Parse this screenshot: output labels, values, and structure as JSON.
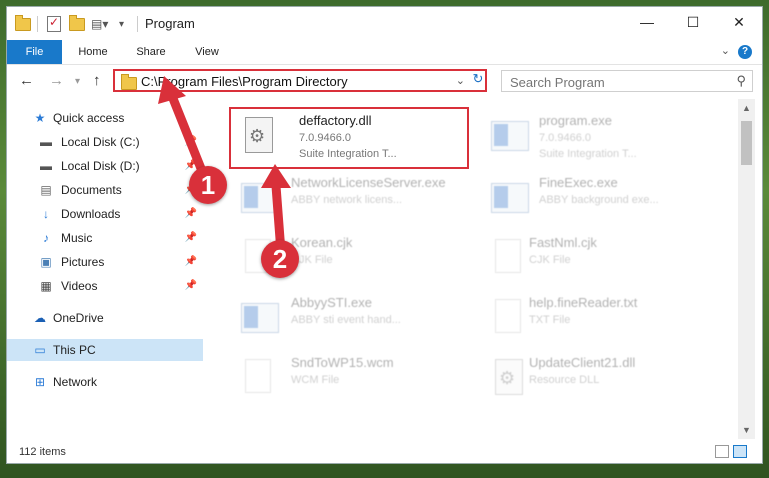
{
  "window": {
    "title": "Program"
  },
  "ribbon": {
    "tabs": [
      "File",
      "Home",
      "Share",
      "View"
    ],
    "help": "?",
    "expand": "⌄"
  },
  "address": {
    "path": "C:\\Program Files\\Program Directory"
  },
  "search": {
    "placeholder": "Search Program"
  },
  "sidebar": {
    "items": [
      {
        "label": "Quick access",
        "icon": "star-icon"
      },
      {
        "label": "Local Disk (C:)",
        "icon": "drive-icon"
      },
      {
        "label": "Local Disk (D:)",
        "icon": "drive-icon"
      },
      {
        "label": "Documents",
        "icon": "documents-icon"
      },
      {
        "label": "Downloads",
        "icon": "downloads-icon"
      },
      {
        "label": "Music",
        "icon": "music-icon"
      },
      {
        "label": "Pictures",
        "icon": "pictures-icon"
      },
      {
        "label": "Videos",
        "icon": "videos-icon"
      },
      {
        "label": "OneDrive",
        "icon": "cloud-icon"
      },
      {
        "label": "This PC",
        "icon": "computer-icon"
      },
      {
        "label": "Network",
        "icon": "network-icon"
      }
    ]
  },
  "files": [
    {
      "name": "deffactory.dll",
      "line2": "7.0.9466.0",
      "line3": "Suite Integration T..."
    },
    {
      "name": "program.exe",
      "line2": "7.0.9466.0",
      "line3": "Suite Integration T..."
    },
    {
      "name": "NetworkLicenseServer.exe",
      "line2": "ABBY network licens...",
      "line3": ""
    },
    {
      "name": "FineExec.exe",
      "line2": "ABBY background exe...",
      "line3": ""
    },
    {
      "name": "Korean.cjk",
      "line2": "CJK File",
      "line3": ""
    },
    {
      "name": "FastNml.cjk",
      "line2": "CJK File",
      "line3": ""
    },
    {
      "name": "AbbyySTI.exe",
      "line2": "ABBY sti event hand...",
      "line3": ""
    },
    {
      "name": "help.fineReader.txt",
      "line2": "TXT File",
      "line3": ""
    },
    {
      "name": "SndToWP15.wcm",
      "line2": "WCM File",
      "line3": ""
    },
    {
      "name": "UpdateClient21.dll",
      "line2": "Resource DLL",
      "line3": ""
    }
  ],
  "status": {
    "count": "112 items"
  },
  "annotations": {
    "one": "1",
    "two": "2"
  },
  "colors": {
    "accent": "#1979ca",
    "highlight": "#d9303a"
  }
}
